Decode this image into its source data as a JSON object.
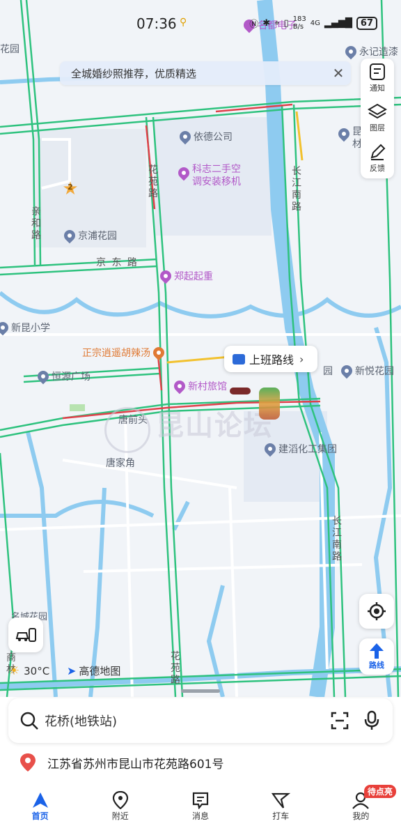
{
  "status_bar": {
    "time": "07:36",
    "net_speed": "183\nB/s",
    "network": "4G",
    "battery": "67"
  },
  "banner": {
    "text": "全城婚纱照推荐，优质精选",
    "close_icon": "close-icon"
  },
  "side_panel": {
    "notify_label": "通知",
    "layers_label": "图层",
    "feedback_label": "反馈"
  },
  "map": {
    "pois": {
      "top_left_garden": "花园",
      "yongji": "永记造漆",
      "yide": "依德公司",
      "kezhi": "科志二手空\n调安装移机",
      "jingpu": "京浦花园",
      "zhengqi": "郑起起重",
      "xinkun_school": "新昆小学",
      "hutang": "正宗逍遥胡辣汤",
      "hengyuan": "恒源广场",
      "xincun_hotel": "新村旅馆",
      "xinyue": "新悦花园",
      "jiansheng": "建滔化工集团",
      "tangqiantou": "唐前头",
      "tangjiajiao": "唐家角",
      "mingcheng": "名城花园",
      "garden_partial": "园",
      "top_right_partial": "昆\n材",
      "pin_top": "名都电子"
    },
    "roads": {
      "huayuan_road_top": "花\n苑\n路",
      "huayuan_road_bottom": "花\n苑\n路",
      "qinhe_road": "亲\n和\n路",
      "jingdong_road": "京 东 路",
      "changjiang_south_top": "长\n江\n南\n路",
      "changjiang_south_bottom": "长\n江\n南\n路",
      "shang_partial": "商\n林"
    },
    "watermark": "昆山论坛",
    "marker_number": "2",
    "commute_route_label": "上班路线",
    "weather_temp": "30°C",
    "amap_logo": "高德地图",
    "locate_icon": "crosshair-icon",
    "route_button_label": "路线"
  },
  "search": {
    "placeholder": "花桥(地铁站)"
  },
  "location": {
    "address": "江苏省苏州市昆山市花苑路601号"
  },
  "tabs": [
    {
      "label": "首页",
      "icon": "home-icon"
    },
    {
      "label": "附近",
      "icon": "nearby-pin-icon"
    },
    {
      "label": "消息",
      "icon": "message-icon"
    },
    {
      "label": "打车",
      "icon": "taxi-icon"
    },
    {
      "label": "我的",
      "icon": "profile-icon",
      "badge": "待点亮"
    }
  ],
  "colors": {
    "accent": "#1a62e8",
    "road_green": "#2ec27e",
    "road_red": "#e0404a",
    "road_yellow": "#f2c12e",
    "water": "#8ecbf0"
  }
}
